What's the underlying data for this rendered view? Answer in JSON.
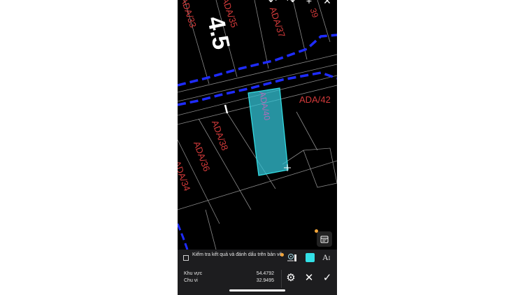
{
  "map": {
    "parcel_labels": [
      "ADA/33",
      "ADA/35",
      "ADA/37",
      "39",
      "ADA/42",
      "ADA/38",
      "ADA/36",
      "ADA/34"
    ],
    "selected_label": "ADA/40",
    "dimension": "4.5",
    "colors": {
      "parcel_label": "#d23a3a",
      "road_boundary": "#1f2cff",
      "selection_fill": "#33c3d6",
      "selection_stroke": "#33e0e6",
      "lines": "#9a9a9a"
    }
  },
  "toolbar": {
    "undo_icon": "undo-icon",
    "redo_icon": "redo-icon",
    "add_icon": "plus-icon",
    "close_icon": "close-icon"
  },
  "controls": {
    "check_label": "Kiểm tra kết quả và đánh dấu trên bản vẽ",
    "text_tool": "A",
    "fill_color": "#33e0e6"
  },
  "measurements": {
    "area_label": "Khu vực",
    "area_value": "54.4792",
    "perimeter_label": "Chu vi",
    "perimeter_value": "32.9495"
  }
}
